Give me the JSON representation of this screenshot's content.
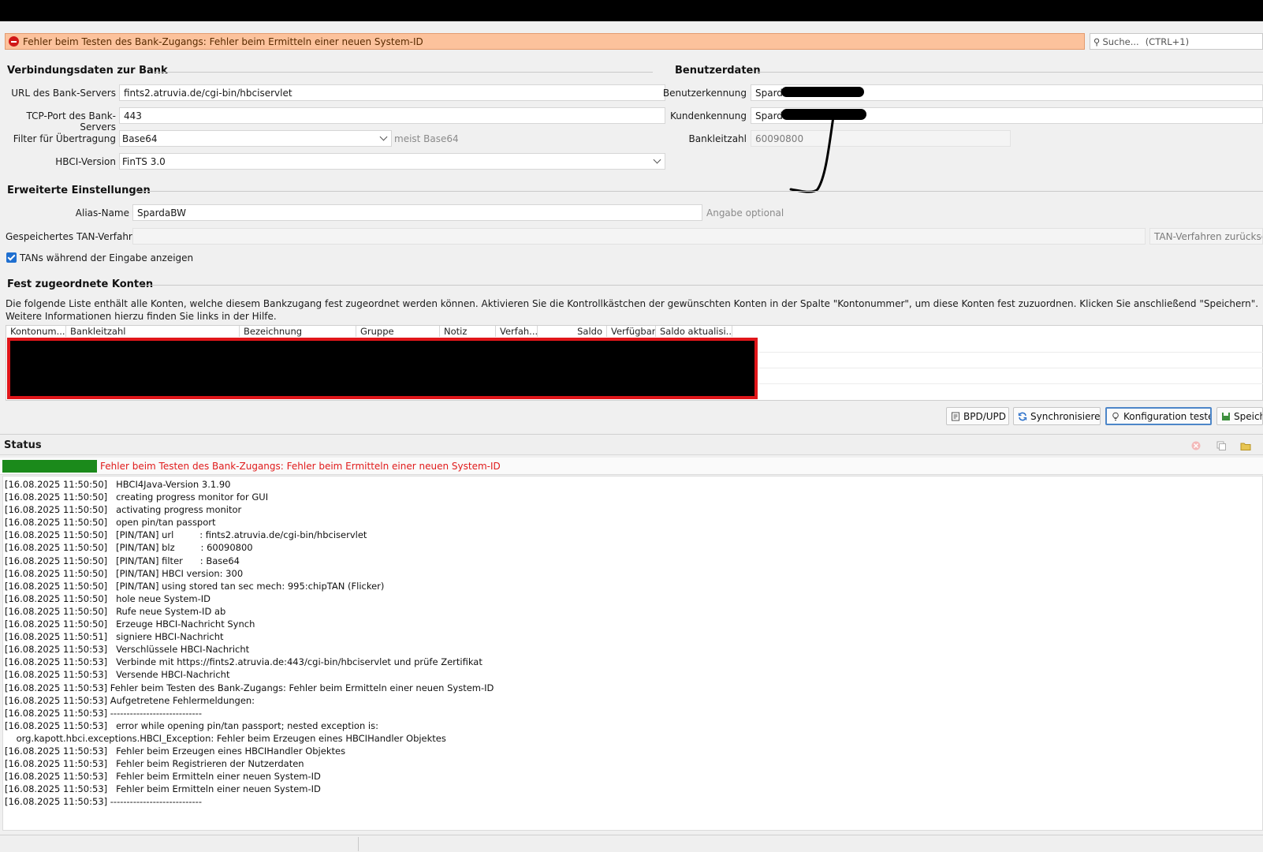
{
  "banner": {
    "error_text": "Fehler beim Testen des Bank-Zugangs: Fehler beim Ermitteln einer neuen System-ID"
  },
  "search": {
    "placeholder": "Suche...",
    "shortcut": "(CTRL+1)"
  },
  "connection": {
    "title": "Verbindungsdaten zur Bank",
    "url_label": "URL des Bank-Servers",
    "url_value": "fints2.atruvia.de/cgi-bin/hbciservlet",
    "port_label": "TCP-Port des Bank-Servers",
    "port_value": "443",
    "filter_label": "Filter für Übertragung",
    "filter_value": "Base64",
    "filter_hint": "meist Base64",
    "hbci_label": "HBCI-Version",
    "hbci_value": "FinTS 3.0"
  },
  "user": {
    "title": "Benutzerdaten",
    "user_id_label": "Benutzerkennung",
    "user_id_value": "Sparda",
    "customer_id_label": "Kundenkennung",
    "customer_id_value": "Sparda",
    "blz_label": "Bankleitzahl",
    "blz_value": "60090800"
  },
  "advanced": {
    "title": "Erweiterte Einstellungen",
    "alias_label": "Alias-Name",
    "alias_value": "SpardaBW",
    "alias_hint": "Angabe optional",
    "tan_label": "Gespeichertes TAN-Verfahren",
    "tan_reset": "TAN-Verfahren zurücksetz",
    "show_tans_label": "TANs während der Eingabe anzeigen"
  },
  "accounts": {
    "title": "Fest zugeordnete Konten",
    "description": "Die folgende Liste enthält alle Konten, welche diesem Bankzugang fest zugeordnet werden können. Aktivieren Sie die Kontrollkästchen der gewünschten Konten in der Spalte \"Kontonummer\", um diese Konten fest zuzuordnen. Klicken Sie anschließend \"Speichern\". Weitere Informationen hierzu finden Sie links in der Hilfe.",
    "columns": [
      "Kontonum...",
      "Bankleitzahl",
      "Bezeichnung",
      "Gruppe",
      "Notiz",
      "Verfah...",
      "Saldo",
      "Verfügbar",
      "Saldo aktualisi..."
    ]
  },
  "buttons": {
    "bpd": "BPD/UPD",
    "sync": "Synchronisieren",
    "test": "Konfiguration testen",
    "save": "Speich"
  },
  "status": {
    "title": "Status",
    "progress": 100,
    "message": "Fehler beim Testen des Bank-Zugangs: Fehler beim Ermitteln einer neuen System-ID",
    "log": [
      "[16.08.2025 11:50:50]   HBCI4Java-Version 3.1.90",
      "[16.08.2025 11:50:50]   creating progress monitor for GUI",
      "[16.08.2025 11:50:50]   activating progress monitor",
      "[16.08.2025 11:50:50]   open pin/tan passport",
      "[16.08.2025 11:50:50]   [PIN/TAN] url         : fints2.atruvia.de/cgi-bin/hbciservlet",
      "[16.08.2025 11:50:50]   [PIN/TAN] blz         : 60090800",
      "[16.08.2025 11:50:50]   [PIN/TAN] filter      : Base64",
      "[16.08.2025 11:50:50]   [PIN/TAN] HBCI version: 300",
      "[16.08.2025 11:50:50]   [PIN/TAN] using stored tan sec mech: 995:chipTAN (Flicker)",
      "[16.08.2025 11:50:50]   hole neue System-ID",
      "[16.08.2025 11:50:50]   Rufe neue System-ID ab",
      "[16.08.2025 11:50:50]   Erzeuge HBCI-Nachricht Synch",
      "[16.08.2025 11:50:51]   signiere HBCI-Nachricht",
      "[16.08.2025 11:50:53]   Verschlüssele HBCI-Nachricht",
      "[16.08.2025 11:50:53]   Verbinde mit https://fints2.atruvia.de:443/cgi-bin/hbciservlet und prüfe Zertifikat",
      "[16.08.2025 11:50:53]   Versende HBCI-Nachricht",
      "[16.08.2025 11:50:53] Fehler beim Testen des Bank-Zugangs: Fehler beim Ermitteln einer neuen System-ID",
      "[16.08.2025 11:50:53] Aufgetretene Fehlermeldungen:",
      "[16.08.2025 11:50:53] ----------------------------",
      "[16.08.2025 11:50:53]   error while opening pin/tan passport; nested exception is:",
      "    org.kapott.hbci.exceptions.HBCI_Exception: Fehler beim Erzeugen eines HBCIHandler Objektes",
      "[16.08.2025 11:50:53]   Fehler beim Erzeugen eines HBCIHandler Objektes",
      "[16.08.2025 11:50:53]   Fehler beim Registrieren der Nutzerdaten",
      "[16.08.2025 11:50:53]   Fehler beim Ermitteln einer neuen System-ID",
      "[16.08.2025 11:50:53]   Fehler beim Ermitteln einer neuen System-ID",
      "[16.08.2025 11:50:53] ----------------------------"
    ]
  }
}
